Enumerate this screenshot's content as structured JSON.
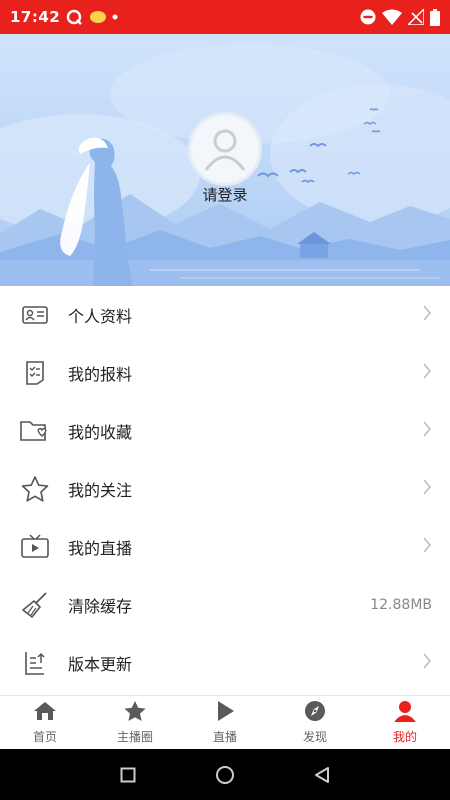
{
  "status_bar": {
    "time": "17:42",
    "color": "#e8211d"
  },
  "profile": {
    "login_label": "请登录"
  },
  "menu": {
    "items": [
      {
        "label": "个人资料",
        "icon": "id-card-icon"
      },
      {
        "label": "我的报料",
        "icon": "checklist-icon"
      },
      {
        "label": "我的收藏",
        "icon": "folder-heart-icon"
      },
      {
        "label": "我的关注",
        "icon": "star-icon"
      },
      {
        "label": "我的直播",
        "icon": "tv-play-icon"
      },
      {
        "label": "清除缓存",
        "icon": "broom-icon",
        "value": "12.88MB"
      },
      {
        "label": "版本更新",
        "icon": "update-icon"
      }
    ]
  },
  "tabbar": {
    "tabs": [
      {
        "label": "首页",
        "icon": "home-icon"
      },
      {
        "label": "主播圈",
        "icon": "star-filled-icon"
      },
      {
        "label": "直播",
        "icon": "play-icon"
      },
      {
        "label": "发现",
        "icon": "compass-icon"
      },
      {
        "label": "我的",
        "icon": "person-icon",
        "active": true
      }
    ],
    "accent": "#e8211d"
  }
}
